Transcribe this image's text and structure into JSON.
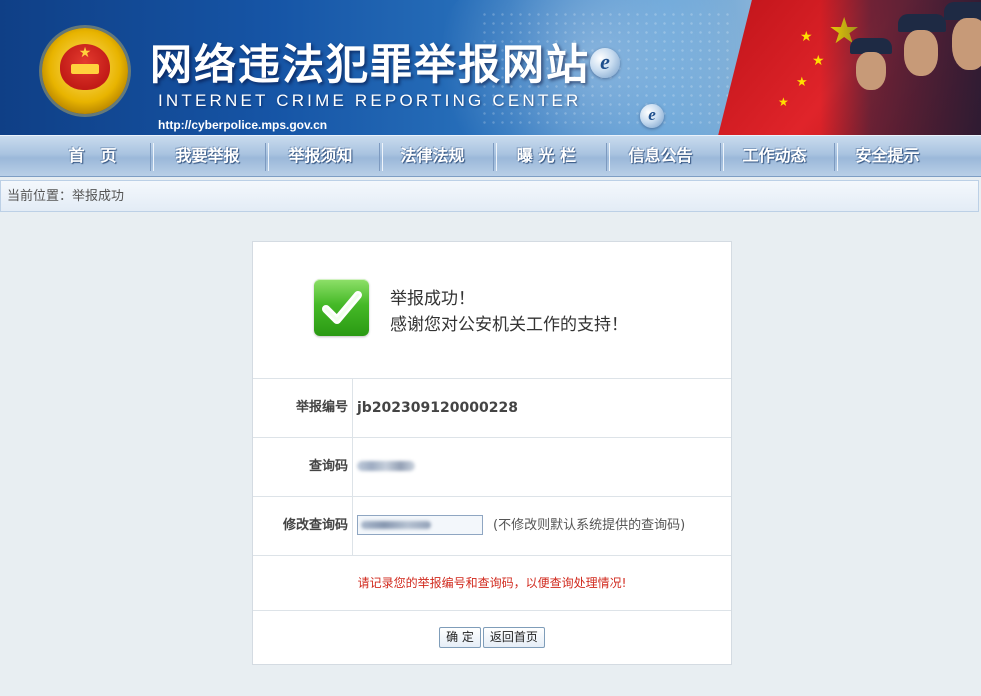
{
  "header": {
    "title": "网络违法犯罪举报网站",
    "subtitle": "INTERNET CRIME REPORTING CENTER",
    "url": "http://cyberpolice.mps.gov.cn"
  },
  "nav": {
    "items": [
      {
        "label": "首　页"
      },
      {
        "label": "我要举报"
      },
      {
        "label": "举报须知"
      },
      {
        "label": "法律法规"
      },
      {
        "label": "曝 光 栏"
      },
      {
        "label": "信息公告"
      },
      {
        "label": "工作动态"
      },
      {
        "label": "安全提示"
      }
    ]
  },
  "breadcrumb": {
    "text": "当前位置：举报成功"
  },
  "result": {
    "success_title": "举报成功！",
    "success_message": "感谢您对公安机关工作的支持！",
    "report_id_label": "举报编号",
    "report_id_value": "jb202309120000228",
    "query_code_label": "查询码",
    "modify_query_label": "修改查询码",
    "modify_query_hint": "(不修改则默认系统提供的查询码)",
    "notice": "请记录您的举报编号和查询码，以便查询处理情况!",
    "confirm_button": "确 定",
    "home_button": "返回首页"
  },
  "colors": {
    "nav_text": "#ffffff",
    "notice_red": "#d12a1e",
    "success_green": "#45b927",
    "page_bg": "#e8eef2"
  },
  "icons": {
    "emblem": "national-emblem-icon",
    "success": "checkmark-icon",
    "brand": "e-logo-icon"
  }
}
